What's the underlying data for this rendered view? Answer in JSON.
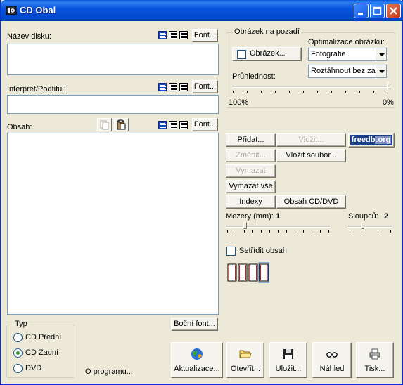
{
  "window": {
    "title": "CD Obal"
  },
  "disk": {
    "label": "Název disku:",
    "font_label": "Font..."
  },
  "artist": {
    "label": "Interpret/Podtitul:",
    "font_label": "Font..."
  },
  "content": {
    "label": "Obsah:",
    "font_label": "Font..."
  },
  "background": {
    "group_title": "Obrázek na pozadí",
    "image_checkbox_label": "Obrázek...",
    "optimize_label": "Optimalizace obrázku:",
    "optimize_value": "Fotografie",
    "stretch_value": "Roztáhnout bez za",
    "transparency_label": "Průhlednost:",
    "transparency_min": "100%",
    "transparency_max": "0%"
  },
  "actions": {
    "add": "Přidat...",
    "insert": "Vložit...",
    "edit": "Změnit...",
    "insert_file": "Vložit soubor...",
    "delete": "Vymazat",
    "delete_all": "Vymazat vše",
    "indexes": "Indexy",
    "cd_contents": "Obsah CD/DVD"
  },
  "freedb": {
    "left": "freedb",
    "right": ".org"
  },
  "spacing": {
    "label": "Mezery (mm):",
    "value": "1"
  },
  "columns": {
    "label": "Sloupců:",
    "value": "2"
  },
  "sort": {
    "label": "Setřídit obsah"
  },
  "side_font": "Boční font...",
  "type": {
    "group_title": "Typ",
    "options": [
      "CD Přední",
      "CD Zadní",
      "DVD"
    ],
    "selected": "CD Zadní"
  },
  "about": "O programu...",
  "toolbar": {
    "update": "Aktualizace...",
    "open": "Otevřít...",
    "save": "Uložit...",
    "preview": "Náhled",
    "print": "Tisk..."
  }
}
